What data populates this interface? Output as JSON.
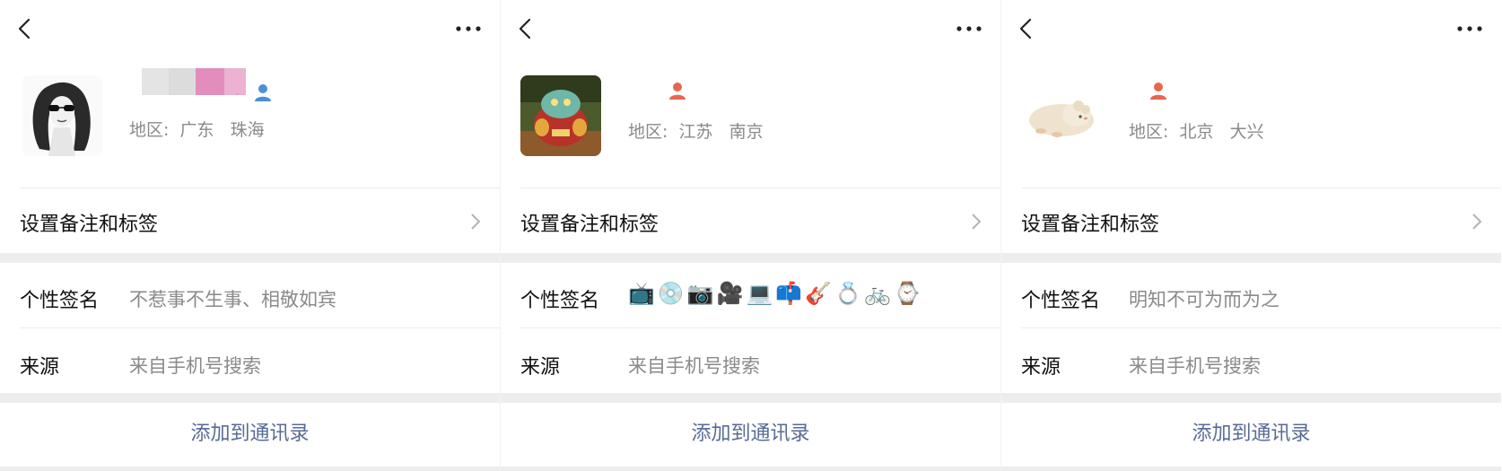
{
  "panels": [
    {
      "region": "地区:  广东   珠海",
      "remark": "设置备注和标签",
      "signature_label": "个性签名",
      "signature": "不惹事不生事、相敬如宾",
      "source_label": "来源",
      "source": "来自手机号搜索",
      "add_button": "添加到通讯录",
      "avatar": "girl-sunglasses-avatar",
      "badge_color": "#4a90d9"
    },
    {
      "region": "地区:  江苏   南京",
      "remark": "设置备注和标签",
      "signature_label": "个性签名",
      "signature_emojis": "📺💿📷🎥💻📫🎸💍🚲⌚",
      "source_label": "来源",
      "source": "来自手机号搜索",
      "add_button": "添加到通讯录",
      "avatar": "toy-figure-avatar",
      "badge_color": "#e8664d"
    },
    {
      "region": "地区:  北京   大兴",
      "remark": "设置备注和标签",
      "signature_label": "个性签名",
      "signature": "明知不可为而为之",
      "source_label": "来源",
      "source": "来自手机号搜索",
      "add_button": "添加到通讯录",
      "avatar": "hamster-avatar",
      "badge_color": "#e8664d"
    }
  ],
  "colors": {
    "link": "#576b95",
    "secondary_text": "#8a8a8a",
    "section_gap": "#ededed"
  }
}
